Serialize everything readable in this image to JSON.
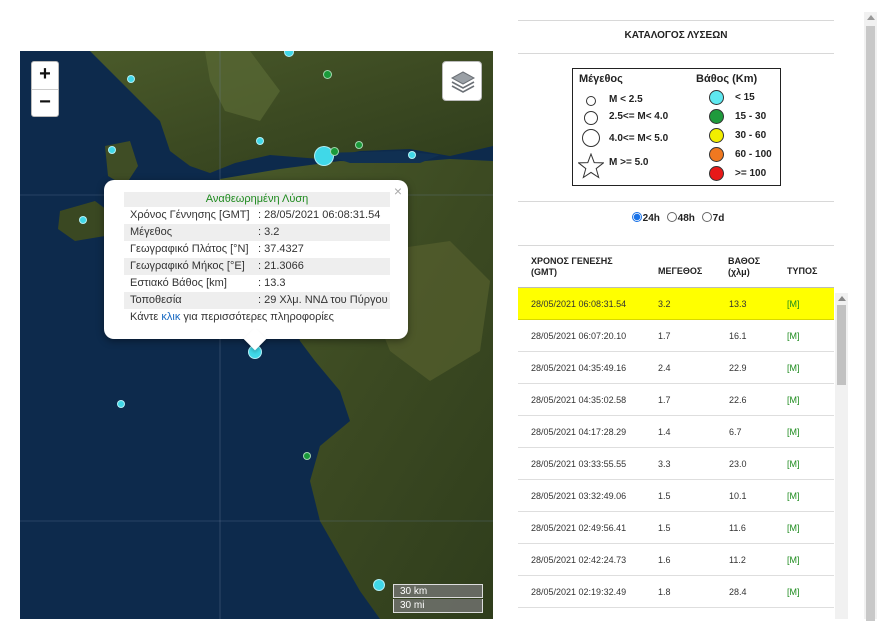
{
  "map": {
    "zoom_in": "+",
    "zoom_out": "−",
    "layers_icon": "layers-icon",
    "scale_km": "30 km",
    "scale_mi": "30 mi",
    "markers": [
      {
        "color": "#40d8e8",
        "depth": "< 15"
      },
      {
        "color": "#1a9a3a",
        "depth": "15 - 30"
      }
    ]
  },
  "popup": {
    "title": "Αναθεωρημένη Λύση",
    "rows": [
      {
        "key": "Χρόνος Γέννησης [GMT]",
        "value": ": 28/05/2021 06:08:31.54"
      },
      {
        "key": "Μέγεθος",
        "value": ": 3.2"
      },
      {
        "key": "Γεωγραφικό Πλάτος [°N]",
        "value": ": 37.4327"
      },
      {
        "key": "Γεωγραφικό Μήκος [°E]",
        "value": ": 21.3066"
      },
      {
        "key": "Εστιακό Βάθος [km]",
        "value": ": 13.3"
      },
      {
        "key": "Τοποθεσία",
        "value": ": 29 Χλμ. ΝΝΔ του Πύργου"
      }
    ],
    "foot_pre": "Κάντε ",
    "foot_link": "κλικ",
    "foot_post": " για περισσότερες πληροφορίες",
    "close": "×"
  },
  "panel": {
    "title": "ΚΑΤΑΛΟΓΟΣ ΛΥΣΕΩΝ",
    "legend": {
      "magnitude_title": "Μέγεθος",
      "depth_title": "Βάθος (Km)",
      "magnitudes": [
        "M < 2.5",
        "2.5<= M< 4.0",
        "4.0<= M< 5.0",
        "M >= 5.0"
      ],
      "depths": [
        {
          "label": "< 15",
          "color": "#5ee8f0"
        },
        {
          "label": "15 - 30",
          "color": "#1f9a3c"
        },
        {
          "label": "30 - 60",
          "color": "#f2ee00"
        },
        {
          "label": "60 - 100",
          "color": "#f07820"
        },
        {
          "label": ">= 100",
          "color": "#e81818"
        }
      ]
    },
    "range": {
      "options": [
        "24h",
        "48h",
        "7d"
      ],
      "selected": "24h"
    },
    "columns": {
      "time_line1": "ΧΡΟΝΟΣ ΓΕΝΕΣΗΣ",
      "time_line2": "(GMT)",
      "magnitude": "ΜΕΓΕΘΟΣ",
      "depth_line1": "ΒΑΘΟΣ",
      "depth_line2": "(χλμ)",
      "type": "ΤΥΠΟΣ"
    },
    "rows": [
      {
        "time": "28/05/2021 06:08:31.54",
        "mag": "3.2",
        "depth": "13.3",
        "type": "[M]"
      },
      {
        "time": "28/05/2021 06:07:20.10",
        "mag": "1.7",
        "depth": "16.1",
        "type": "[M]"
      },
      {
        "time": "28/05/2021 04:35:49.16",
        "mag": "2.4",
        "depth": "22.9",
        "type": "[M]"
      },
      {
        "time": "28/05/2021 04:35:02.58",
        "mag": "1.7",
        "depth": "22.6",
        "type": "[M]"
      },
      {
        "time": "28/05/2021 04:17:28.29",
        "mag": "1.4",
        "depth": "6.7",
        "type": "[M]"
      },
      {
        "time": "28/05/2021 03:33:55.55",
        "mag": "3.3",
        "depth": "23.0",
        "type": "[M]"
      },
      {
        "time": "28/05/2021 03:32:49.06",
        "mag": "1.5",
        "depth": "10.1",
        "type": "[M]"
      },
      {
        "time": "28/05/2021 02:49:56.41",
        "mag": "1.5",
        "depth": "11.6",
        "type": "[M]"
      },
      {
        "time": "28/05/2021 02:42:24.73",
        "mag": "1.6",
        "depth": "11.2",
        "type": "[M]"
      },
      {
        "time": "28/05/2021 02:19:32.49",
        "mag": "1.8",
        "depth": "28.4",
        "type": "[M]"
      }
    ]
  }
}
